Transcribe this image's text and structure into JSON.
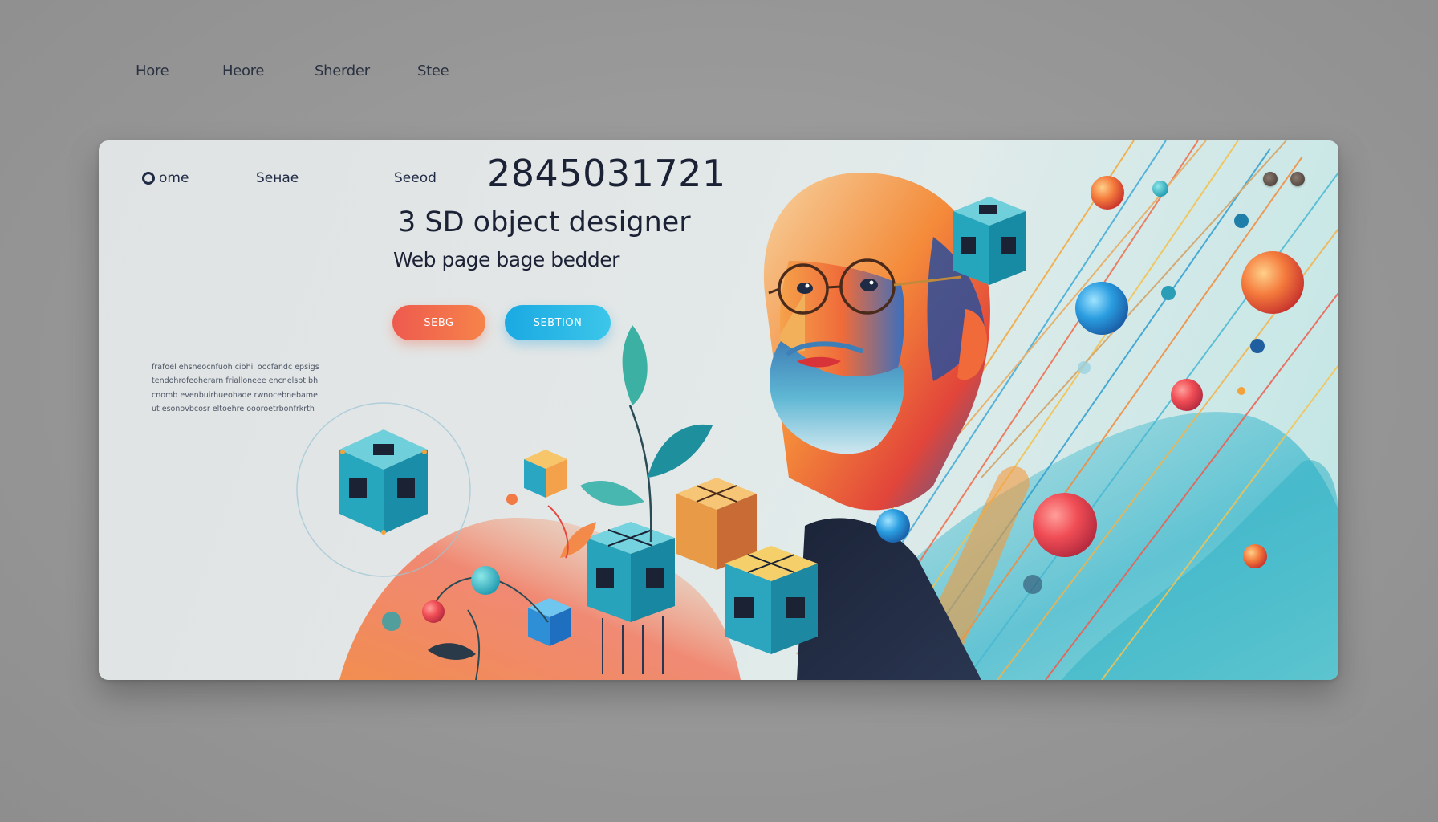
{
  "top_nav": {
    "items": [
      {
        "label": "Hore"
      },
      {
        "label": "Heore"
      },
      {
        "label": "Sherder"
      },
      {
        "label": "Stee"
      }
    ]
  },
  "card": {
    "nav": {
      "home_label": "ome",
      "item2_label": "Seнae",
      "item3_label": "Seeod"
    },
    "seed_number": "2845031721",
    "title": "3 SD object designer",
    "subtitle": "Web page bage bedder",
    "primary_button": "SEBG",
    "secondary_button": "SEBTION",
    "body_text": "frafoel ehsneocnfuoh cibhil oocfandc epsigstendohrofeoherarn frialloneee encnelspt bhcnomb evenbuirhueohade rwnocebnebameut esonovbcosr eltoehre oooroetrbonfrkrth"
  },
  "colors": {
    "background": "#999999",
    "card_left": "#e2e5e5",
    "card_right": "#bfe6e5",
    "accent_orange": "#f26a4b",
    "accent_blue": "#2bb6e6",
    "accent_teal": "#2eb7c4",
    "text_dark": "#1c2236"
  },
  "icons": {
    "home": "circle-icon",
    "window_controls": [
      "window-dot-icon",
      "window-dot-icon"
    ]
  },
  "illustration": {
    "subject": "bald-bearded-man-with-glasses",
    "elements": [
      "circuit-cube",
      "sphere",
      "leaf-plant",
      "diagonal-lines",
      "wave"
    ]
  }
}
